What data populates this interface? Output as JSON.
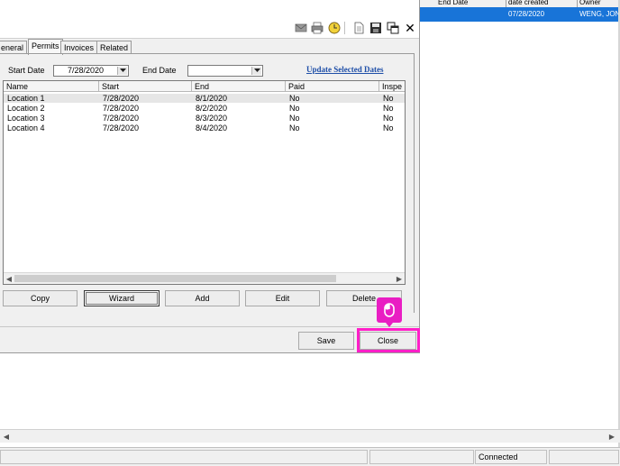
{
  "grid": {
    "headers": [
      "End Date",
      "date created",
      "Owner"
    ],
    "selected_row": [
      "",
      "07/28/2020",
      "WENG, JON"
    ],
    "selection_color": "#1874d8"
  },
  "toolbar": {
    "icons": [
      "envelope-icon",
      "printer-icon",
      "clock-icon",
      "new-document-icon",
      "save-disk-icon",
      "copy-windows-icon",
      "close-x-icon"
    ],
    "close_glyph": "✕"
  },
  "tabs": [
    {
      "label": "eneral",
      "active": false
    },
    {
      "label": "Permits",
      "active": true
    },
    {
      "label": "Invoices",
      "active": false
    },
    {
      "label": "Related",
      "active": false
    }
  ],
  "filters": {
    "start_label": "Start Date",
    "start_value": "7/28/2020",
    "end_label": "End Date",
    "end_value": "",
    "update_link": "Update Selected Dates"
  },
  "list": {
    "columns": [
      "Name",
      "Start",
      "End",
      "Paid",
      "Inspe"
    ],
    "rows": [
      [
        "Location 1",
        "7/28/2020",
        "8/1/2020",
        "No",
        "No"
      ],
      [
        "Location 2",
        "7/28/2020",
        "8/2/2020",
        "No",
        "No"
      ],
      [
        "Location 3",
        "7/28/2020",
        "8/3/2020",
        "No",
        "No"
      ],
      [
        "Location 4",
        "7/28/2020",
        "8/4/2020",
        "No",
        "No"
      ]
    ],
    "selected_row_index": 0
  },
  "actions": {
    "copy": "Copy",
    "wizard": "Wizard",
    "add": "Add",
    "edit": "Edit",
    "delete": "Delete"
  },
  "dialog_footer": {
    "save": "Save",
    "close": "Close",
    "highlight_color": "#ff1ec8"
  },
  "status": {
    "connection": "Connected"
  }
}
